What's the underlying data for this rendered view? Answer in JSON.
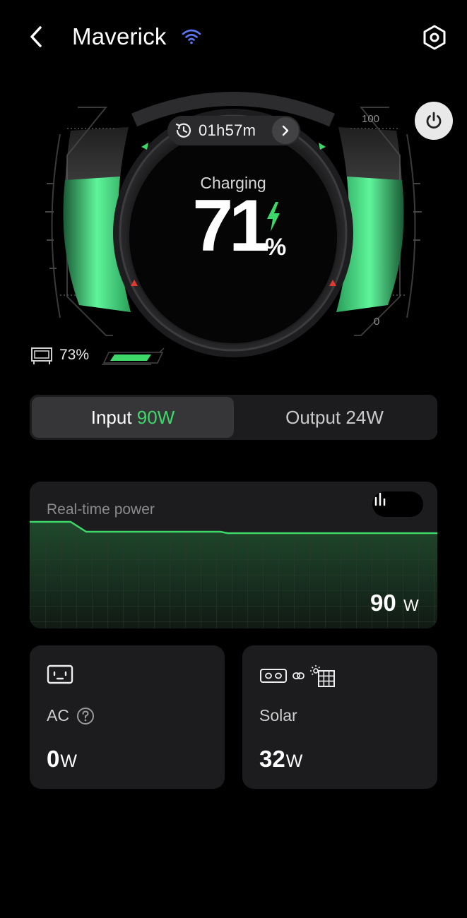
{
  "header": {
    "title": "Maverick",
    "back_icon": "chevron-left-icon",
    "wifi_icon": "wifi-icon",
    "settings_icon": "settings-icon"
  },
  "gauge": {
    "remaining_time": "01h57m",
    "status": "Charging",
    "percent": "71",
    "percent_sign": "%",
    "scale_max": "100",
    "scale_min": "0",
    "secondary_battery": "73%",
    "secondary_battery_level": 0.73,
    "charge_level": 0.71
  },
  "tabs": {
    "input_label": "Input",
    "input_value": "90W",
    "output_label": "Output",
    "output_value": "24W"
  },
  "realtime": {
    "title": "Real-time power",
    "value": "90",
    "unit": "W"
  },
  "sources": {
    "ac": {
      "label": "AC",
      "value": "0",
      "unit": "W"
    },
    "solar": {
      "label": "Solar",
      "value": "32",
      "unit": "W"
    }
  },
  "colors": {
    "accent_green": "#3ed86a",
    "warning_red": "#e5382f",
    "wifi_blue": "#5b78f2",
    "background": "#000000",
    "card": "#1c1c1e"
  }
}
